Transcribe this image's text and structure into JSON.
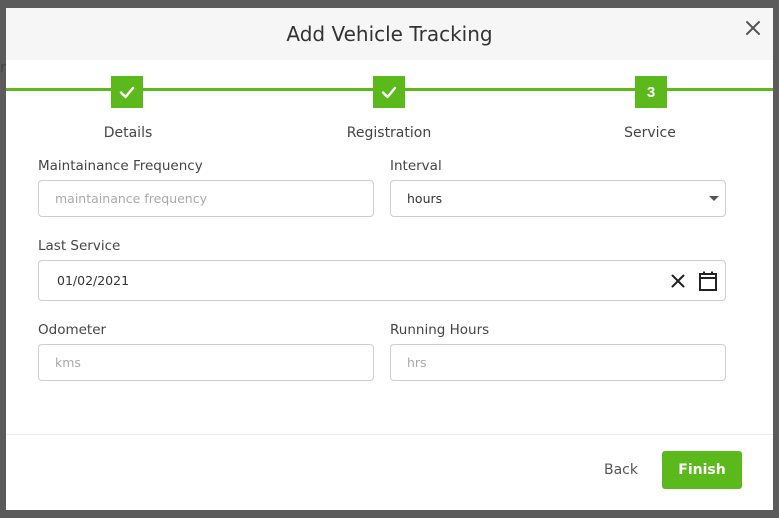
{
  "modal": {
    "title": "Add Vehicle Tracking",
    "steps": [
      {
        "label": "Details",
        "status": "complete",
        "icon": "check-icon"
      },
      {
        "label": "Registration",
        "status": "complete",
        "icon": "check-icon"
      },
      {
        "label": "Service",
        "status": "active",
        "number": "3"
      }
    ],
    "fields": {
      "maintenance_frequency": {
        "label": "Maintainance Frequency",
        "placeholder": "maintainance frequency",
        "value": ""
      },
      "interval": {
        "label": "Interval",
        "value": "hours"
      },
      "last_service": {
        "label": "Last Service",
        "value": "01/02/2021"
      },
      "odometer": {
        "label": "Odometer",
        "placeholder": "kms",
        "value": ""
      },
      "running_hours": {
        "label": "Running Hours",
        "placeholder": "hrs",
        "value": ""
      }
    },
    "footer": {
      "back_label": "Back",
      "finish_label": "Finish"
    }
  },
  "colors": {
    "accent": "#5cb91b",
    "overlay": "#5b5b5b",
    "header_bg": "#f6f6f6"
  }
}
